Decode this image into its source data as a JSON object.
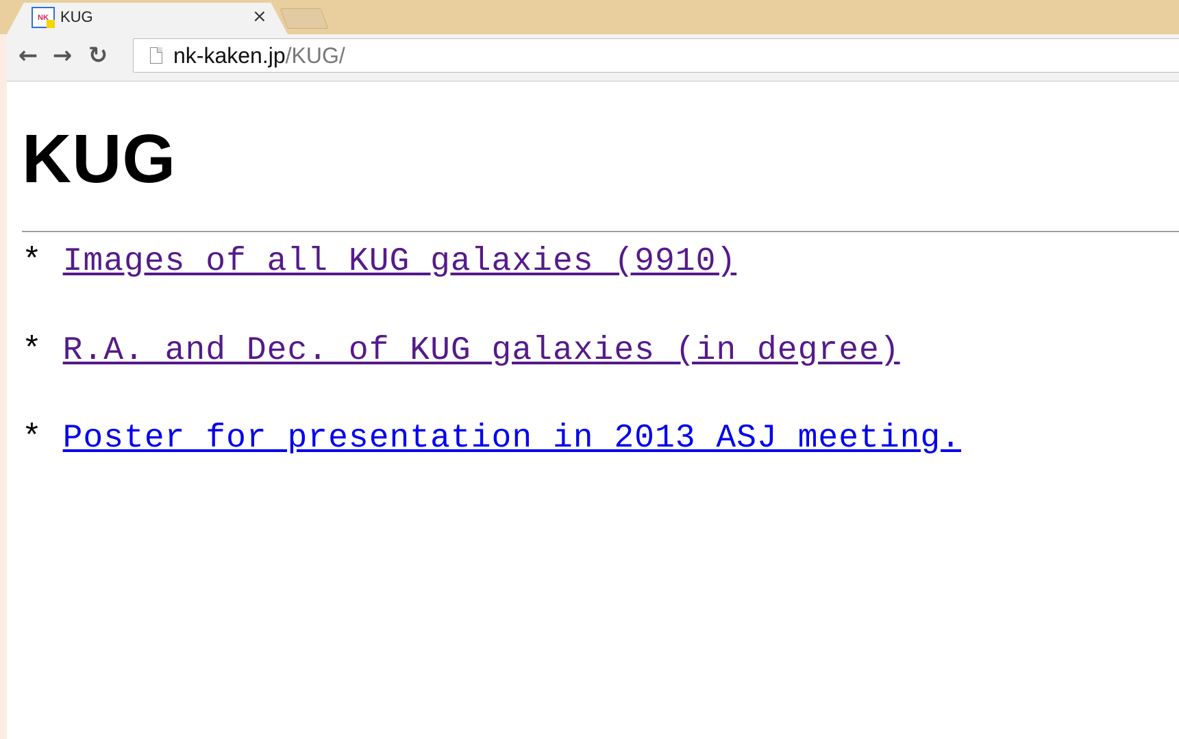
{
  "browser": {
    "tab": {
      "title": "KUG",
      "favicon_text": "NK",
      "close_glyph": "×"
    },
    "nav": {
      "back_glyph": "←",
      "forward_glyph": "→",
      "reload_glyph": "↻"
    },
    "address": {
      "host": "nk-kaken.jp",
      "path": "/KUG/"
    }
  },
  "page": {
    "title": "KUG",
    "bullet": "*",
    "links": [
      {
        "label": "Images of all KUG galaxies (9910)",
        "state": "visited"
      },
      {
        "label": "R.A. and Dec. of KUG galaxies (in degree) ",
        "state": "visited"
      },
      {
        "label": "Poster for presentation in 2013 ASJ meeting.",
        "state": "unvisited"
      }
    ]
  },
  "colors": {
    "tabstrip": "#e8cf9d",
    "visited_link": "#551a8b",
    "unvisited_link": "#0000ee"
  },
  "icons": [
    "nk-favicon-icon",
    "close-icon",
    "back-arrow-icon",
    "forward-arrow-icon",
    "reload-icon",
    "page-icon"
  ]
}
